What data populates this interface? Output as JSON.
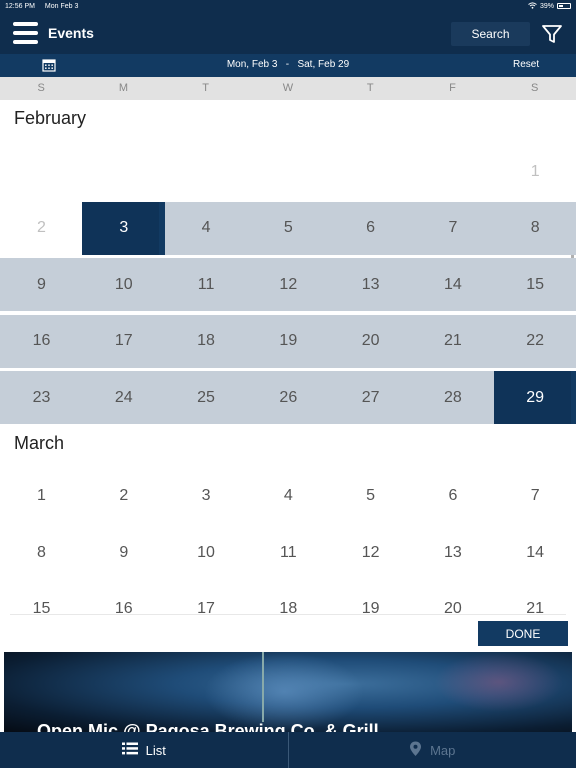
{
  "status_bar": {
    "time": "12:56 PM",
    "date": "Mon Feb 3",
    "battery": "39%"
  },
  "header": {
    "title": "Events",
    "search_label": "Search"
  },
  "date_bar": {
    "start": "Mon, Feb 3",
    "separator": "-",
    "end": "Sat, Feb 29",
    "reset_label": "Reset"
  },
  "weekdays": [
    "S",
    "M",
    "T",
    "W",
    "T",
    "F",
    "S"
  ],
  "months": [
    {
      "name": "February",
      "weeks": [
        [
          "",
          "",
          "",
          "",
          "",
          "",
          "1"
        ],
        [
          "2",
          "3",
          "4",
          "5",
          "6",
          "7",
          "8"
        ],
        [
          "9",
          "10",
          "11",
          "12",
          "13",
          "14",
          "15"
        ],
        [
          "16",
          "17",
          "18",
          "19",
          "20",
          "21",
          "22"
        ],
        [
          "23",
          "24",
          "25",
          "26",
          "27",
          "28",
          "29"
        ]
      ]
    },
    {
      "name": "March",
      "weeks": [
        [
          "1",
          "2",
          "3",
          "4",
          "5",
          "6",
          "7"
        ],
        [
          "8",
          "9",
          "10",
          "11",
          "12",
          "13",
          "14"
        ],
        [
          "15",
          "16",
          "17",
          "18",
          "19",
          "20",
          "21"
        ]
      ]
    }
  ],
  "selection": {
    "start_day": "3",
    "end_day": "29"
  },
  "done_label": "DONE",
  "event": {
    "title": "Open Mic @ Pagosa Brewing Co. & Grill"
  },
  "tabs": {
    "list_label": "List",
    "map_label": "Map"
  },
  "colors": {
    "header": "#0f2d4d",
    "range": "#c5ced8",
    "selected": "#0f3358"
  }
}
